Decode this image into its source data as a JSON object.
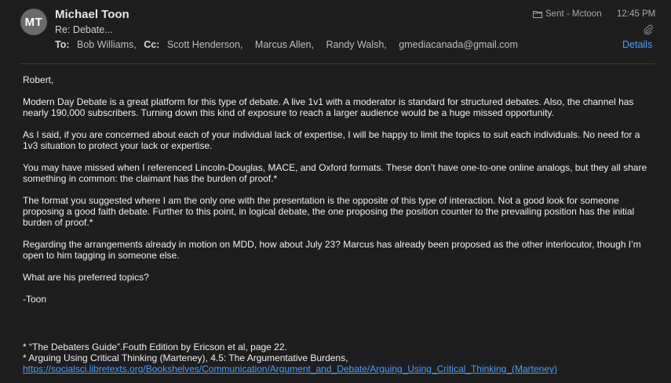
{
  "header": {
    "avatar_initials": "MT",
    "sender": "Michael Toon",
    "subject": "Re: Debate...",
    "mailbox": "Sent - Mctoon",
    "time": "12:45 PM",
    "to_label": "To:",
    "to": "Bob Williams,",
    "cc_label": "Cc:",
    "cc": [
      "Scott Henderson,",
      "Marcus Allen,",
      "Randy Walsh,",
      "gmediacanada@gmail.com"
    ],
    "details_label": "Details",
    "colors": {
      "accent": "#4a9eff",
      "background": "#1e1e1e"
    },
    "icons": {
      "mailbox": "folder-icon",
      "attachment": "paperclip-icon"
    }
  },
  "body": {
    "greeting": "Robert,",
    "paragraphs": [
      "Modern Day Debate is a great platform for this type of debate.   A live 1v1 with a moderator is standard for structured debates.  Also, the channel has nearly 190,000 subscribers.  Turning down this kind of exposure to reach a larger audience would be a huge missed opportunity.",
      "As I said, if you are concerned about each of your individual lack of expertise, I will be happy to limit the topics to suit each individuals.  No need for a 1v3 situation to protect your lack or expertise.",
      "You may have missed when I referenced Lincoln-Douglas, MACE, and Oxford formats.  These don’t have one-to-one online analogs, but they all share something in common: the claimant has the burden of proof.*",
      "The format you suggested where I am the only one with the presentation is the opposite of this type of interaction.  Not a good look for someone proposing a good faith debate.  Further to this point, in logical debate, the one proposing the position counter to the prevailing position has the initial burden of proof.*",
      "Regarding the arrangements already in motion on MDD, how about July 23?  Marcus has already been proposed as the other interlocutor, though I’m open to him tagging in someone else.",
      "What are his preferred topics?"
    ],
    "signature": "-Toon"
  },
  "footnotes": {
    "note1": "* “The Debaters Guide”.Fouth Edition by Ericson et al, page 22.",
    "note2": "* Arguing Using Critical Thinking (Marteney), 4.5: The Argumentative Burdens,",
    "link": "https://socialsci.libretexts.org/Bookshelves/Communication/Argument_and_Debate/Arguing_Using_Critical_Thinking_(Marteney)"
  }
}
